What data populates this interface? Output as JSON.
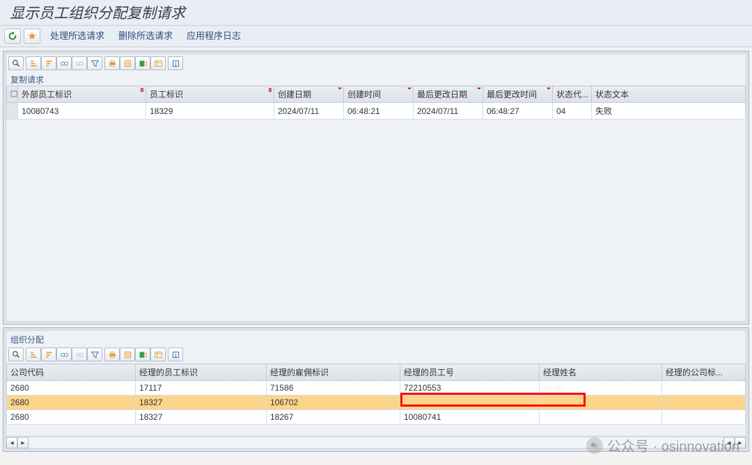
{
  "title": "显示员工组织分配复制请求",
  "menu": {
    "process": "处理所选请求",
    "delete": "删除所选请求",
    "log": "应用程序日志"
  },
  "section1": {
    "caption": "复制请求",
    "columns": {
      "ext_emp_id": "外部员工标识",
      "emp_id": "员工标识",
      "create_date": "创建日期",
      "create_time": "创建时间",
      "last_date": "最后更改日期",
      "last_time": "最后更改时间",
      "status_code": "状态代...",
      "status_text": "状态文本"
    },
    "rows": [
      {
        "ext_emp_id": "10080743",
        "emp_id": "18329",
        "create_date": "2024/07/11",
        "create_time": "06:48:21",
        "last_date": "2024/07/11",
        "last_time": "06:48:27",
        "status_code": "04",
        "status_text": "失败"
      }
    ]
  },
  "section2": {
    "caption": "组织分配",
    "columns": {
      "company": "公司代码",
      "mgr_emp_id": "经理的员工标识",
      "mgr_hire_id": "经理的雇佣标识",
      "mgr_emp_no": "经理的员工号",
      "mgr_name": "经理姓名",
      "mgr_company": "经理的公司标..."
    },
    "rows": [
      {
        "company": "2680",
        "mgr_emp_id": "17117",
        "mgr_hire_id": "71586",
        "mgr_emp_no": "72210553",
        "mgr_name": "··· ···",
        "mgr_company": ""
      },
      {
        "company": "2680",
        "mgr_emp_id": "18327",
        "mgr_hire_id": "106702",
        "mgr_emp_no": "",
        "mgr_name": "",
        "mgr_company": ""
      },
      {
        "company": "2680",
        "mgr_emp_id": "18327",
        "mgr_hire_id": "18267",
        "mgr_emp_no": "10080741",
        "mgr_name": "",
        "mgr_company": ""
      }
    ]
  },
  "watermark": "公众号 · osinnovation"
}
